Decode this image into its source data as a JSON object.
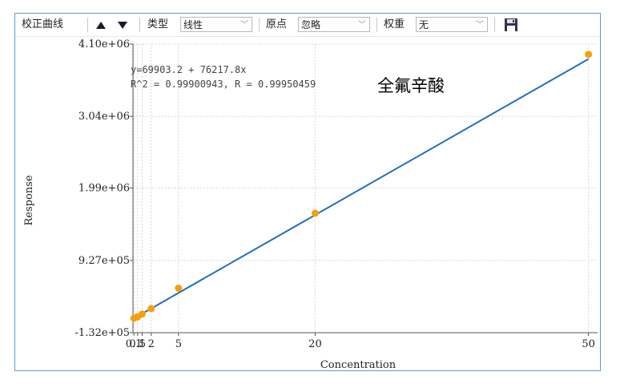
{
  "toolbar": {
    "curve_label": "校正曲线",
    "type_label": "类型",
    "type_value": "线性",
    "origin_label": "原点",
    "origin_value": "忽略",
    "weight_label": "权重",
    "weight_value": "无"
  },
  "colors": {
    "line": "#1f6fbf",
    "points": "#f5a00a",
    "frame": "#5b9bd5"
  },
  "icons": [
    "arrow-up-icon",
    "arrow-down-icon",
    "save-icon"
  ],
  "chart_data": {
    "type": "scatter",
    "title": "全氟辛酸",
    "xlabel": "Concentration",
    "ylabel": "Response",
    "equation": "y=69903.2 + 76217.8x",
    "r_text": "R^2 = 0.99900943, R = 0.99950459",
    "xlim": [
      0,
      51
    ],
    "ylim": [
      -132000,
      4100000
    ],
    "x_ticks": [
      0.1,
      0.5,
      1,
      2,
      5,
      20,
      50
    ],
    "x_tick_labels": [
      "0.1",
      "0.5",
      "1",
      "2",
      "5",
      "20",
      "50"
    ],
    "y_ticks": [
      -132000,
      927000,
      1990000,
      3040000,
      4100000
    ],
    "y_tick_labels": [
      "-1.32e+05",
      "9.27e+05",
      "1.99e+06",
      "3.04e+06",
      "4.10e+06"
    ],
    "points": [
      {
        "x": 0.1,
        "y": 80000
      },
      {
        "x": 0.5,
        "y": 100000
      },
      {
        "x": 1,
        "y": 140000
      },
      {
        "x": 2,
        "y": 220000
      },
      {
        "x": 5,
        "y": 520000
      },
      {
        "x": 20,
        "y": 1620000
      },
      {
        "x": 50,
        "y": 3950000
      }
    ],
    "fit": {
      "intercept": 69903.2,
      "slope": 76217.8
    },
    "grid": true
  }
}
